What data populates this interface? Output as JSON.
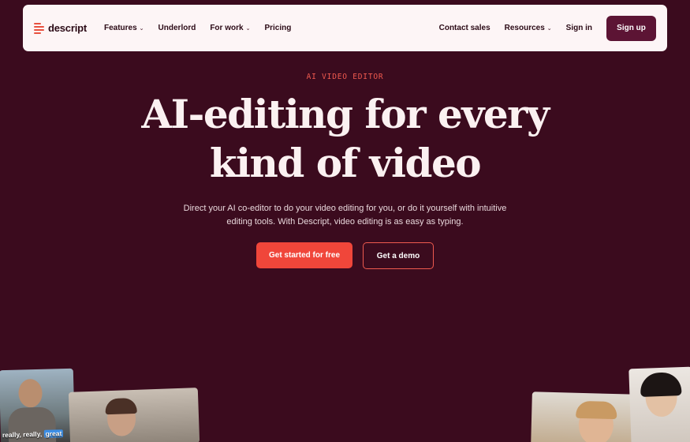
{
  "nav": {
    "logo_text": "descript",
    "left_items": [
      {
        "label": "Features",
        "has_dropdown": true
      },
      {
        "label": "Underlord",
        "has_dropdown": false
      },
      {
        "label": "For work",
        "has_dropdown": true
      },
      {
        "label": "Pricing",
        "has_dropdown": false
      }
    ],
    "right_items": [
      {
        "label": "Contact sales",
        "has_dropdown": false
      },
      {
        "label": "Resources",
        "has_dropdown": true
      },
      {
        "label": "Sign in",
        "has_dropdown": false
      }
    ],
    "signup_label": "Sign up"
  },
  "hero": {
    "eyebrow": "AI VIDEO EDITOR",
    "headline_line1": "AI-editing for every",
    "headline_line2": "kind of video",
    "subcopy": "Direct your AI co-editor to do your video editing for you, or do it yourself with intuitive editing tools. With Descript, video editing is as easy as typing.",
    "primary_cta": "Get started for free",
    "secondary_cta": "Get a demo"
  },
  "thumbnails": {
    "caption_words": [
      "really,",
      "really,",
      "great"
    ]
  },
  "colors": {
    "background": "#3b0b1e",
    "nav_bg": "#fdf5f6",
    "accent": "#f0463a",
    "signup_bg": "#5c1434"
  },
  "icons": {
    "dropdown": "chevron-down-icon",
    "logo": "descript-logo-icon"
  }
}
